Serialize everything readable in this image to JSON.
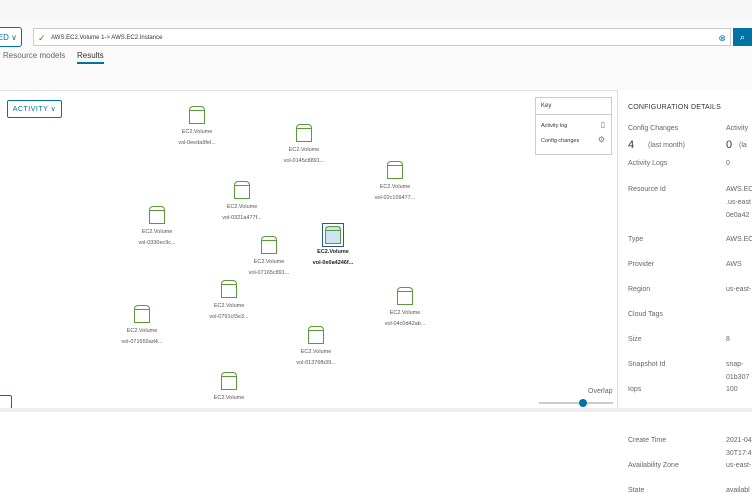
{
  "toolbar": {
    "select_label": "ED ∨",
    "query": "AWS.EC2.Volume 1-> AWS.EC2.Instance",
    "check": "✓",
    "clear": "⊗",
    "search": "⌕"
  },
  "tabs": [
    {
      "label": "Resource models",
      "active": false
    },
    {
      "label": "Results",
      "active": true
    }
  ],
  "activity_button": "ACTIVITY ∨",
  "key": {
    "title": "Key",
    "items": [
      {
        "label": "Activity log",
        "icon": "▯"
      },
      {
        "label": "Config changes",
        "icon": "⚙"
      }
    ]
  },
  "nodes": [
    {
      "type": "EC2.Volume",
      "id": "vol-0eeda9fel..."
    },
    {
      "type": "EC2.Volume",
      "id": "vol-0145c8891..."
    },
    {
      "type": "EC2.Volume",
      "id": "vol-02c109477..."
    },
    {
      "type": "EC2.Volume",
      "id": "vol-0321a477f..."
    },
    {
      "type": "EC2.Volume",
      "id": "vol-0330ec9c..."
    },
    {
      "type": "EC2.Volume",
      "id": "vol-0e0a4246f...",
      "selected": true
    },
    {
      "type": "EC2.Volume",
      "id": "vol-07165c891..."
    },
    {
      "type": "EC2.Volume",
      "id": "vol-0791cf3e3..."
    },
    {
      "type": "EC2.Volume",
      "id": "vol-071659ad4..."
    },
    {
      "type": "EC2.Volume",
      "id": "vol-04c0d42ab..."
    },
    {
      "type": "EC2.Volume",
      "id": "vol-01376fb39..."
    },
    {
      "type": "EC2.Volume",
      "id": ""
    }
  ],
  "overlap": {
    "label": "Overlap",
    "value": 0.6
  },
  "details": {
    "title": "CONFIGURATION DETAILS",
    "config_changes_label": "Config Changes",
    "config_changes": "4",
    "config_changes_period": "(last month)",
    "activity_label": "Activity",
    "activity": "0",
    "activity_period": "(la",
    "rows": [
      {
        "k": "Activity Logs",
        "v": [
          "0"
        ]
      },
      {
        "k": "Resource Id",
        "v": [
          "AWS.EC",
          ".us-east",
          "0e0a42"
        ]
      },
      {
        "k": "Type",
        "v": [
          "AWS.EC"
        ]
      },
      {
        "k": "Provider",
        "v": [
          "AWS"
        ]
      },
      {
        "k": "Region",
        "v": [
          "us-east-"
        ]
      },
      {
        "k": "Cloud Tags",
        "v": []
      },
      {
        "k": "Size",
        "v": [
          "8"
        ]
      },
      {
        "k": "Snapshot Id",
        "v": [
          "snap-",
          "01b307"
        ]
      },
      {
        "k": "Iops",
        "v": [
          "100"
        ]
      },
      {
        "k": "Create Time",
        "v": [
          "2021-04",
          "30T17:4"
        ]
      },
      {
        "k": "Availability Zone",
        "v": [
          "us-east-"
        ]
      },
      {
        "k": "State",
        "v": [
          "availabl"
        ]
      }
    ]
  }
}
